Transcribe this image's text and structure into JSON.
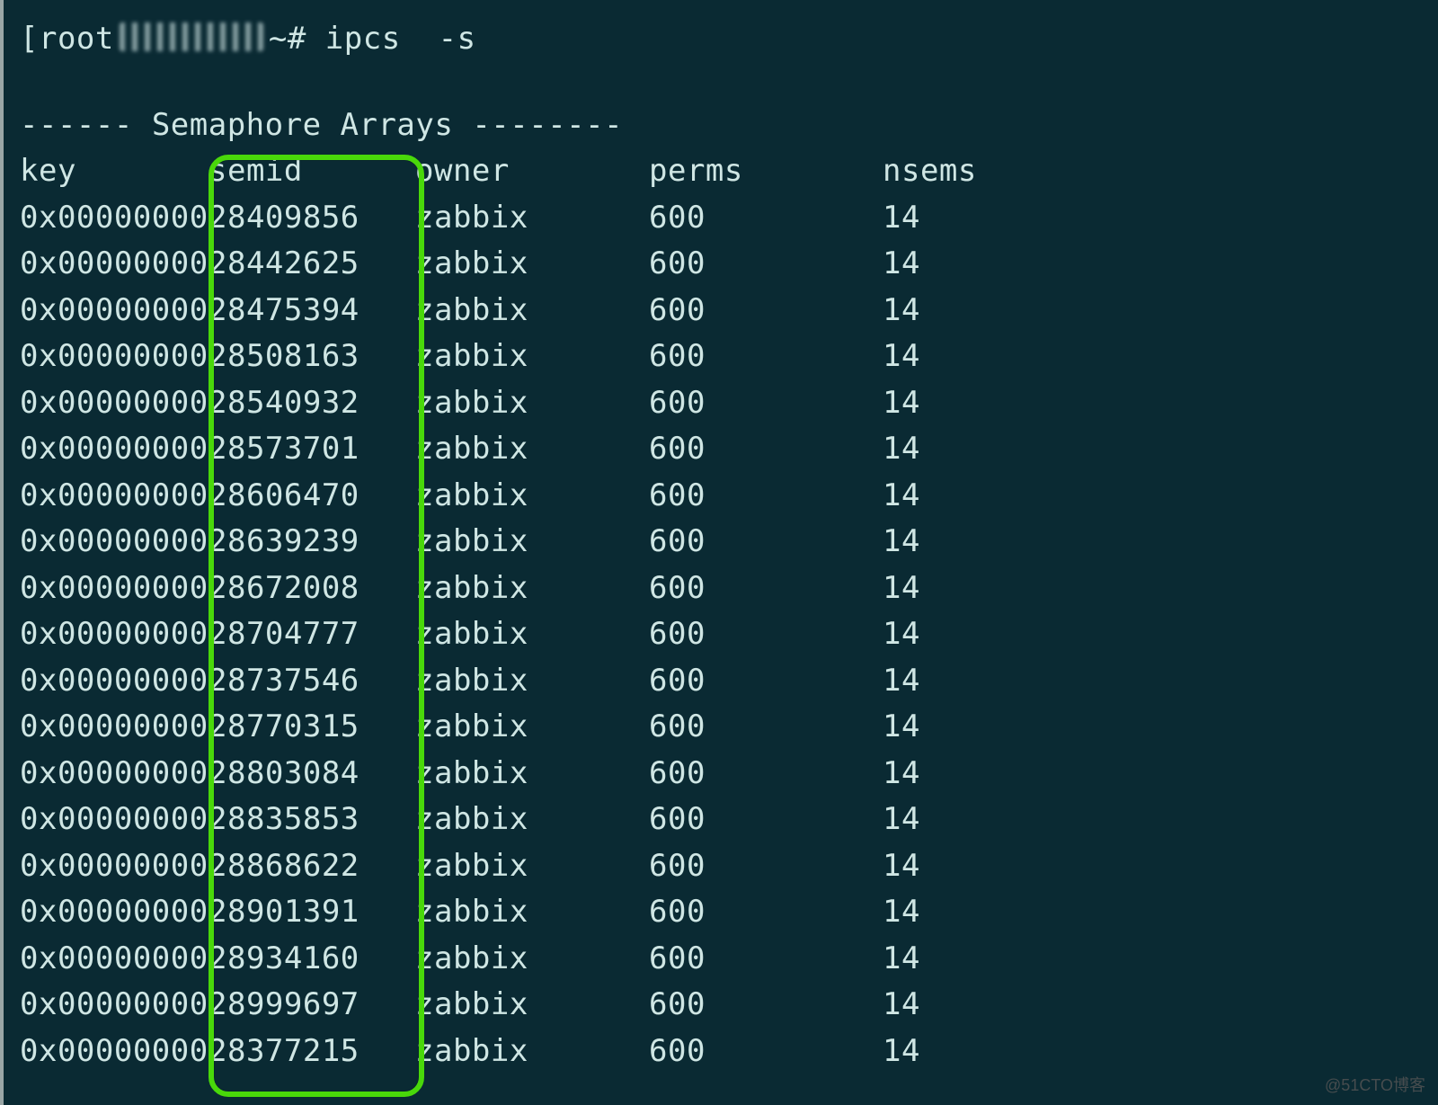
{
  "prompt": {
    "user": "root",
    "host_redacted": true,
    "tail": "~# ",
    "command": "ipcs  -s"
  },
  "section_dashes_left": "------",
  "section_title": "Semaphore Arrays",
  "section_dashes_right": "--------",
  "columns": {
    "key": "key",
    "semid": "semid",
    "owner": "owner",
    "perms": "perms",
    "nsems": "nsems"
  },
  "rows": [
    {
      "key": "0x00000000",
      "semid": "28409856",
      "owner": "zabbix",
      "perms": "600",
      "nsems": "14"
    },
    {
      "key": "0x00000000",
      "semid": "28442625",
      "owner": "zabbix",
      "perms": "600",
      "nsems": "14"
    },
    {
      "key": "0x00000000",
      "semid": "28475394",
      "owner": "zabbix",
      "perms": "600",
      "nsems": "14"
    },
    {
      "key": "0x00000000",
      "semid": "28508163",
      "owner": "zabbix",
      "perms": "600",
      "nsems": "14"
    },
    {
      "key": "0x00000000",
      "semid": "28540932",
      "owner": "zabbix",
      "perms": "600",
      "nsems": "14"
    },
    {
      "key": "0x00000000",
      "semid": "28573701",
      "owner": "zabbix",
      "perms": "600",
      "nsems": "14"
    },
    {
      "key": "0x00000000",
      "semid": "28606470",
      "owner": "zabbix",
      "perms": "600",
      "nsems": "14"
    },
    {
      "key": "0x00000000",
      "semid": "28639239",
      "owner": "zabbix",
      "perms": "600",
      "nsems": "14"
    },
    {
      "key": "0x00000000",
      "semid": "28672008",
      "owner": "zabbix",
      "perms": "600",
      "nsems": "14"
    },
    {
      "key": "0x00000000",
      "semid": "28704777",
      "owner": "zabbix",
      "perms": "600",
      "nsems": "14"
    },
    {
      "key": "0x00000000",
      "semid": "28737546",
      "owner": "zabbix",
      "perms": "600",
      "nsems": "14"
    },
    {
      "key": "0x00000000",
      "semid": "28770315",
      "owner": "zabbix",
      "perms": "600",
      "nsems": "14"
    },
    {
      "key": "0x00000000",
      "semid": "28803084",
      "owner": "zabbix",
      "perms": "600",
      "nsems": "14"
    },
    {
      "key": "0x00000000",
      "semid": "28835853",
      "owner": "zabbix",
      "perms": "600",
      "nsems": "14"
    },
    {
      "key": "0x00000000",
      "semid": "28868622",
      "owner": "zabbix",
      "perms": "600",
      "nsems": "14"
    },
    {
      "key": "0x00000000",
      "semid": "28901391",
      "owner": "zabbix",
      "perms": "600",
      "nsems": "14"
    },
    {
      "key": "0x00000000",
      "semid": "28934160",
      "owner": "zabbix",
      "perms": "600",
      "nsems": "14"
    },
    {
      "key": "0x00000000",
      "semid": "28999697",
      "owner": "zabbix",
      "perms": "600",
      "nsems": "14"
    },
    {
      "key": "0x00000000",
      "semid": "28377215",
      "owner": "zabbix",
      "perms": "600",
      "nsems": "14"
    }
  ],
  "highlight": {
    "column": "semid"
  },
  "watermark": "@51CTO博客"
}
